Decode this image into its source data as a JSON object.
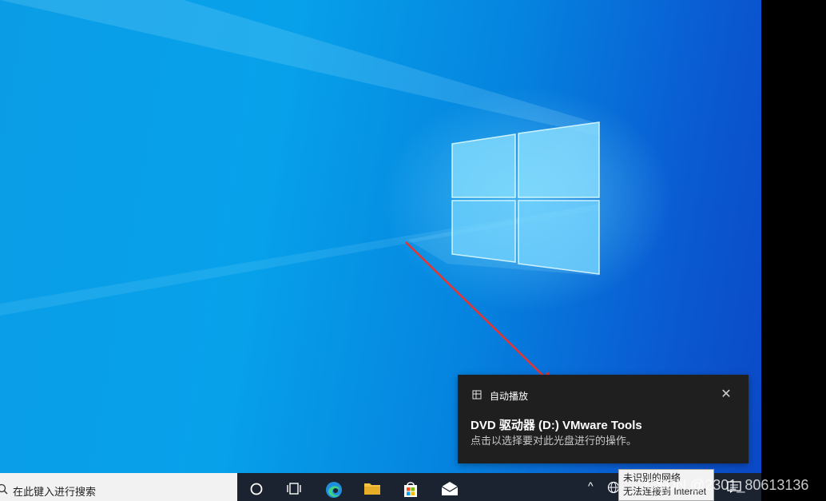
{
  "notification": {
    "app_name": "自动播放",
    "title": "DVD 驱动器 (D:) VMware Tools",
    "body": "点击以选择要对此光盘进行的操作。",
    "app_icon": "autoplay-icon",
    "close_icon": "close-icon",
    "close_glyph": "✕"
  },
  "taskbar": {
    "search_placeholder": "在此键入进行搜索",
    "search_icon": "search-icon",
    "buttons": [
      {
        "name": "cortana-button",
        "icon": "circle-icon"
      },
      {
        "name": "task-view-button",
        "icon": "task-view-icon"
      },
      {
        "name": "edge-button",
        "icon": "edge-icon"
      },
      {
        "name": "file-explorer-button",
        "icon": "folder-icon"
      },
      {
        "name": "microsoft-store-button",
        "icon": "store-icon"
      },
      {
        "name": "mail-button",
        "icon": "mail-icon"
      }
    ],
    "tray_chevron": "^"
  },
  "network_tooltip": {
    "line1": "未识别的网络",
    "line2": "无法连接到 Internet"
  },
  "watermark": "CSDN @2301_80613136",
  "colors": {
    "desktop_blue": "#0a9de6",
    "toast_bg": "#1f1f1f",
    "taskbar_bg": "#1b2330",
    "arrow_red": "#e8342f"
  }
}
